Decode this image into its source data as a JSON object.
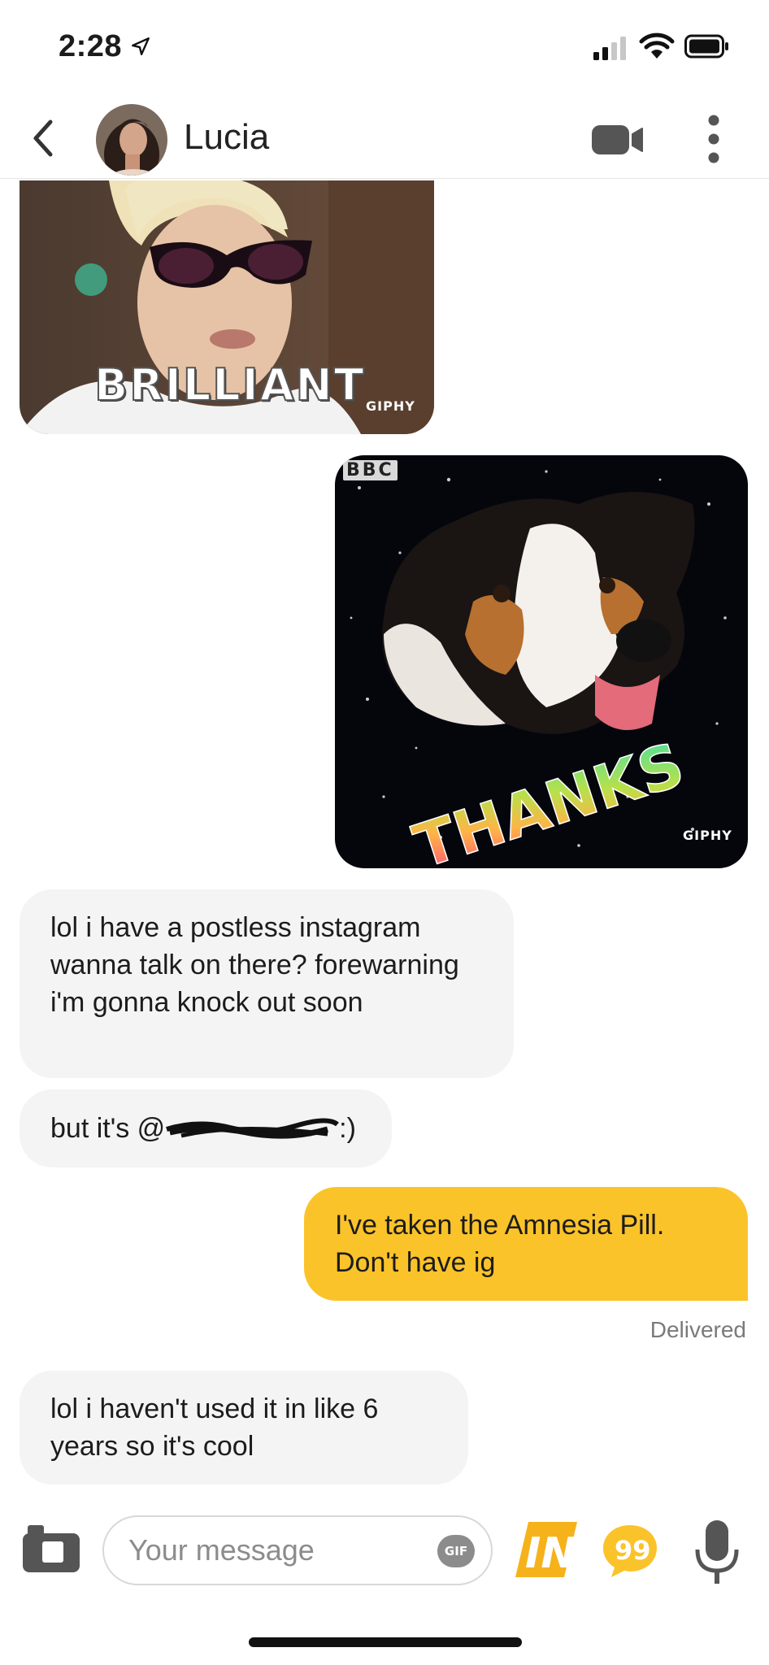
{
  "status_bar": {
    "time": "2:28",
    "icons": [
      "location-arrow-icon",
      "cellular-signal-icon",
      "wifi-icon",
      "battery-icon"
    ]
  },
  "header": {
    "contact_name": "Lucia",
    "icons": [
      "back-chevron-icon",
      "avatar",
      "video-call-icon",
      "more-options-icon"
    ]
  },
  "messages": {
    "gif_brilliant": {
      "caption": "BRILLIANT",
      "source": "GIPHY"
    },
    "gif_thanks": {
      "caption": "THANKS",
      "source": "GIPHY",
      "channel_logo": "BBC"
    },
    "msg_1": {
      "text": "lol i have a postless instagram wanna talk on there? forewarning i'm gonna knock out soon"
    },
    "msg_2": {
      "prefix": "but it's @",
      "suffix": ":)"
    },
    "msg_3": {
      "text": "I've taken the Amnesia Pill. Don't have ig"
    },
    "status": "Delivered",
    "msg_4": {
      "text": "lol i haven't used it in like 6 years so it's cool"
    }
  },
  "composer": {
    "placeholder": "Your message",
    "gif_label": "GIF",
    "in_label": "IN",
    "quote_label": "99"
  },
  "colors": {
    "accent": "#fbc32a",
    "incoming_bubble": "#f4f4f5",
    "text": "#1c1c1c",
    "muted": "#7a7a7a"
  }
}
